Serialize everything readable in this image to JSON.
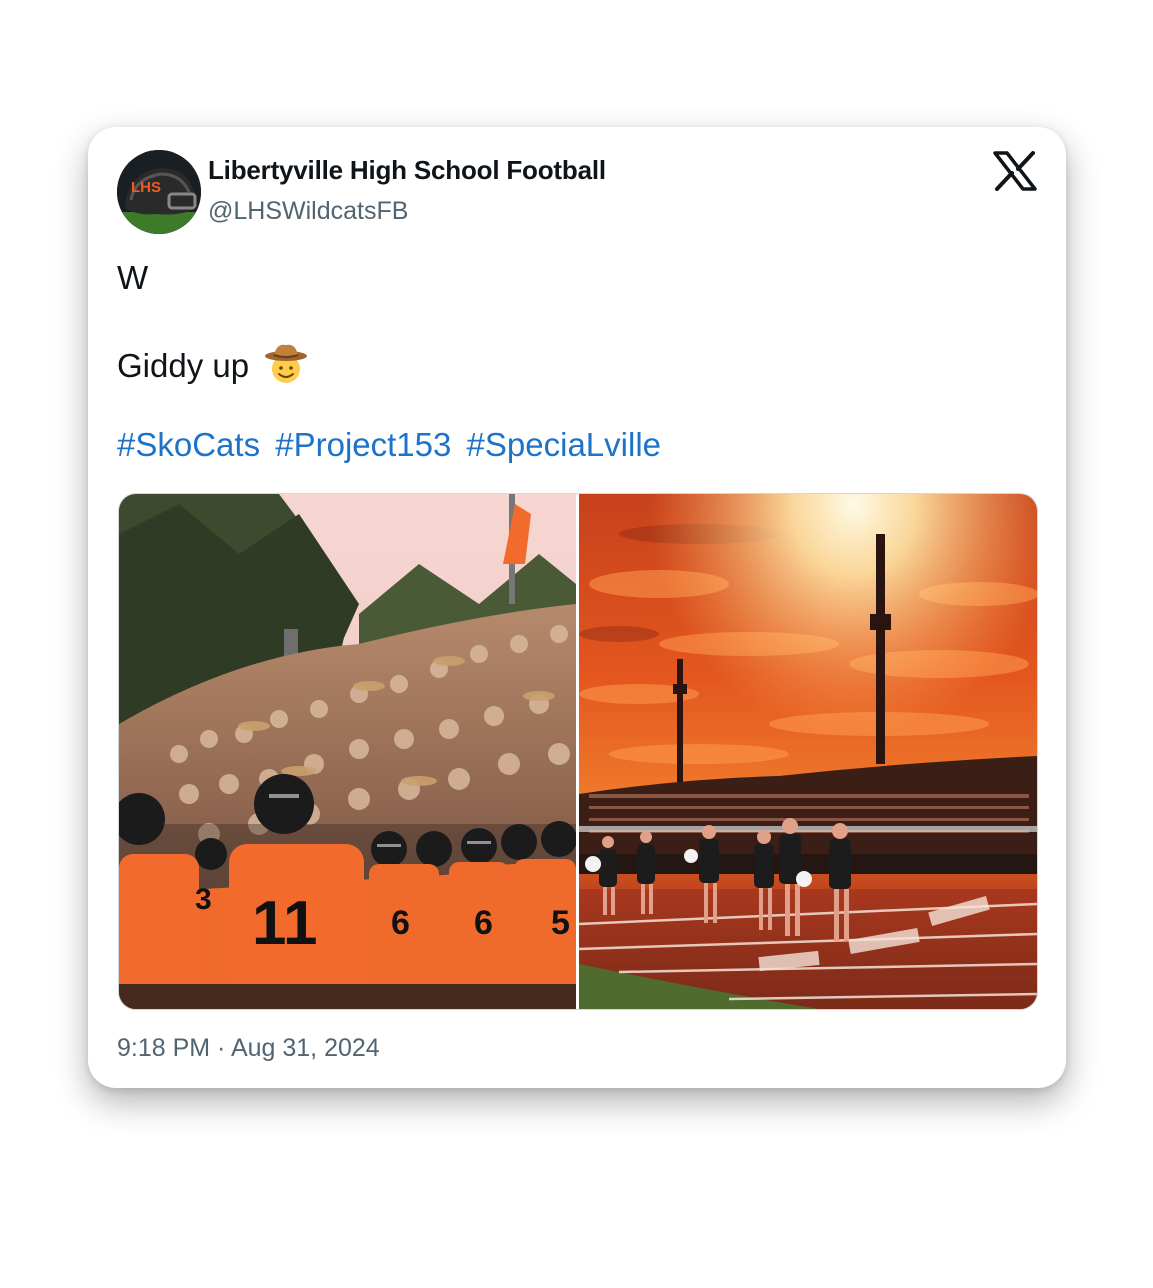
{
  "tweet": {
    "display_name": "Libertyville High School Football",
    "handle": "@LHSWildcatsFB",
    "lines": [
      "W",
      "Giddy up"
    ],
    "emoji": "cowboy-hat-face",
    "hashtags": [
      "#SkoCats",
      "#Project153",
      "#SpeciaLville"
    ],
    "timestamp": "9:18 PM · Aug 31, 2024",
    "avatar_text": "LHS",
    "logo": "x-logo"
  },
  "media": [
    {
      "name": "student-section-photo",
      "jersey_numbers": [
        "11",
        "6",
        "6",
        "5",
        "3"
      ]
    },
    {
      "name": "sunset-stadium-photo"
    }
  ],
  "colors": {
    "link": "#1d73c9",
    "text": "#0f1419",
    "secondary": "#536471",
    "accent_orange": "#f15a22"
  }
}
